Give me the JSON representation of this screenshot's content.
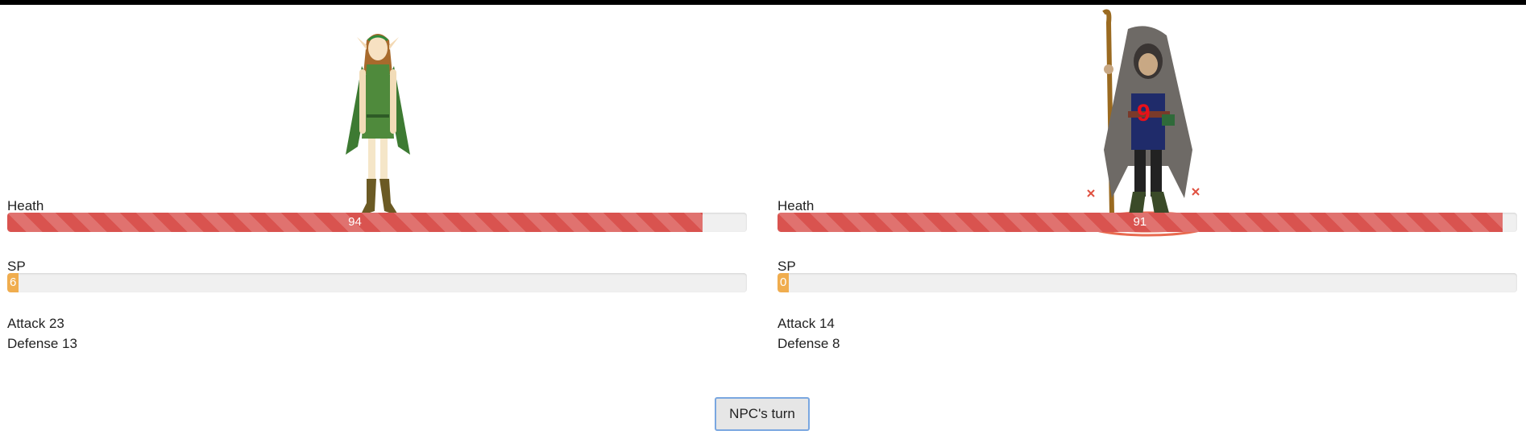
{
  "player": {
    "health_label": "Heath",
    "health_value": "94",
    "health_pct": 94,
    "sp_label": "SP",
    "sp_value": "6",
    "sp_pct": 1.5,
    "attack_text": "Attack 23",
    "defense_text": "Defense 13",
    "sprite": "elf-ranger-icon"
  },
  "npc": {
    "health_label": "Heath",
    "health_value": "91",
    "health_pct": 98,
    "sp_label": "SP",
    "sp_value": "0",
    "sp_pct": 1.5,
    "attack_text": "Attack 14",
    "defense_text": "Defense 8",
    "damage_popup": "9",
    "sprite": "hooded-wizard-icon"
  },
  "turn_button_label": "NPC's turn",
  "colors": {
    "health": "#d9534f",
    "sp": "#f0ad4e",
    "damage": "#e8101a"
  }
}
